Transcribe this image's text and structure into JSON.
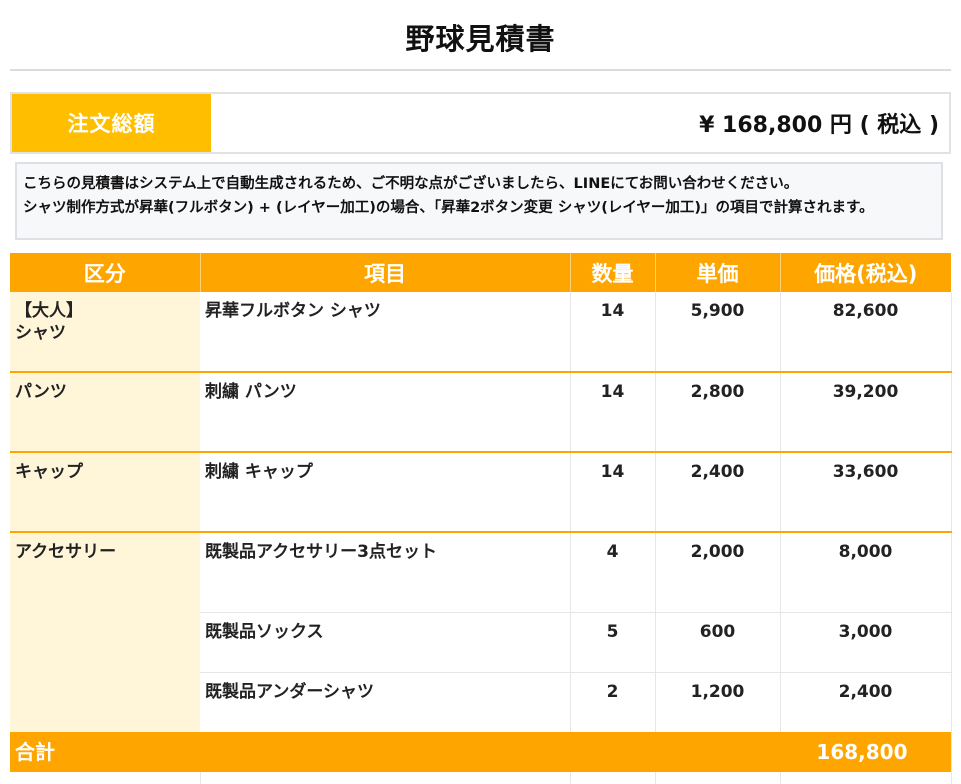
{
  "page": {
    "title": "野球見積書"
  },
  "summary": {
    "label": "注文総額",
    "value": "¥ 168,800 円 ( 税込 )"
  },
  "notice": {
    "line1": "こちらの見積書はシステム上で自動生成されるため、ご不明な点がございましたら、LINEにてお問い合わせください。",
    "line2": "シャツ制作方式が昇華(フルボタン) + (レイヤー加工)の場合、「昇華2ボタン変更 シャツ(レイヤー加工)」の項目で計算されます。"
  },
  "table": {
    "headers": [
      "区分",
      "項目",
      "数量",
      "単価",
      "価格(税込)"
    ],
    "groups": [
      {
        "category_line1": "【大人】",
        "category_line2": "シャツ",
        "items": [
          {
            "name": "昇華フルボタン シャツ",
            "qty": "14",
            "unit_price": "5,900",
            "price": "82,600"
          }
        ]
      },
      {
        "category_line1": "パンツ",
        "items": [
          {
            "name": "刺繍 パンツ",
            "qty": "14",
            "unit_price": "2,800",
            "price": "39,200"
          }
        ]
      },
      {
        "category_line1": "キャップ",
        "items": [
          {
            "name": "刺繍 キャップ",
            "qty": "14",
            "unit_price": "2,400",
            "price": "33,600"
          }
        ]
      },
      {
        "category_line1": "アクセサリー",
        "items": [
          {
            "name": "既製品アクセサリー3点セット",
            "qty": "4",
            "unit_price": "2,000",
            "price": "8,000"
          },
          {
            "name": "既製品ソックス",
            "qty": "5",
            "unit_price": "600",
            "price": "3,000"
          },
          {
            "name": "既製品アンダーシャツ",
            "qty": "2",
            "unit_price": "1,200",
            "price": "2,400"
          }
        ]
      }
    ],
    "total_label": "合計",
    "total_value": "168,800"
  },
  "colors": {
    "summary_label_bg": "#ffbf00",
    "header_bg": "#ffa500",
    "category_bg": "#fff6da",
    "notice_bg": "#f7f8fa"
  }
}
